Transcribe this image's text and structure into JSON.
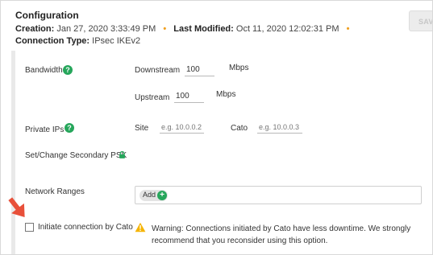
{
  "header": {
    "title": "Configuration",
    "creation_label": "Creation:",
    "creation_value": "Jan 27, 2020 3:33:49 PM",
    "modified_label": "Last Modified:",
    "modified_value": "Oct 11, 2020 12:02:31 PM",
    "connection_type_label": "Connection Type:",
    "connection_type_value": "IPsec IKEv2",
    "save_label": "SAVE"
  },
  "bandwidth": {
    "label": "Bandwidth",
    "downstream_label": "Downstream",
    "downstream_value": "100",
    "downstream_unit": "Mbps",
    "upstream_label": "Upstream",
    "upstream_value": "100",
    "upstream_unit": "Mbps"
  },
  "private_ips": {
    "label": "Private IPs",
    "site_label": "Site",
    "site_placeholder": "e.g. 10.0.0.2",
    "cato_label": "Cato",
    "cato_placeholder": "e.g. 10.0.0.3"
  },
  "psk": {
    "label": "Set/Change Secondary PSK"
  },
  "network_ranges": {
    "label": "Network Ranges",
    "add_label": "Add"
  },
  "initiate": {
    "label": "Initiate connection by Cato",
    "checked": false,
    "warning": "Warning: Connections initiated by Cato have less downtime. We strongly recommend that you reconsider using this option."
  },
  "colors": {
    "accent_green": "#26a65b",
    "warning_orange": "#f0a020",
    "arrow_red": "#e8503a"
  },
  "icons": {
    "help": "question-circle-icon",
    "lock": "lock-icon",
    "add": "plus-circle-icon",
    "warning": "warning-triangle-icon",
    "pointer": "red-arrow-icon"
  }
}
